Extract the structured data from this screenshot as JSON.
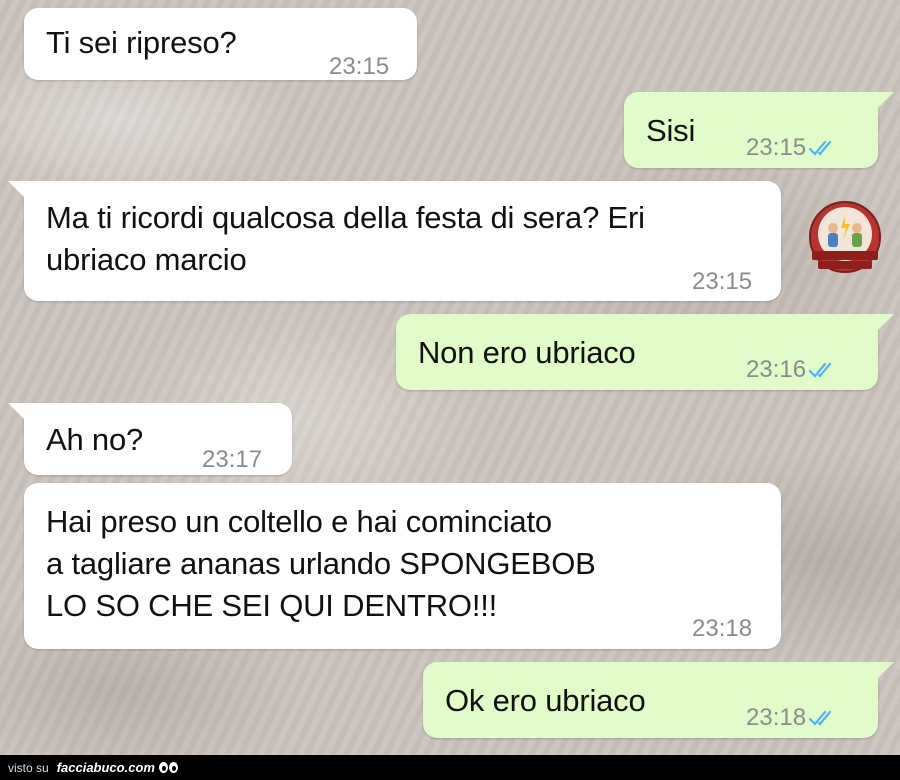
{
  "messages": [
    {
      "id": "b1",
      "direction": "incoming",
      "text": "Ti sei ripreso?",
      "time": "23:15"
    },
    {
      "id": "b2",
      "direction": "outgoing",
      "text": "Sisi",
      "time": "23:15",
      "status": "read"
    },
    {
      "id": "b3",
      "direction": "incoming",
      "text": "Ma ti ricordi qualcosa della festa di sera? Eri ubriaco marcio",
      "time": "23:15"
    },
    {
      "id": "b4",
      "direction": "outgoing",
      "text": "Non ero ubriaco",
      "time": "23:16",
      "status": "read"
    },
    {
      "id": "b5",
      "direction": "incoming",
      "text": "Ah no?",
      "time": "23:17"
    },
    {
      "id": "b6",
      "direction": "incoming",
      "text": "Hai preso un coltello e hai cominciato\na tagliare ananas urlando SPONGEBOB\nLO SO CHE SEI QUI DENTRO!!!",
      "time": "23:18"
    },
    {
      "id": "b7",
      "direction": "outgoing",
      "text": "Ok ero ubriaco",
      "time": "23:18",
      "status": "read"
    }
  ],
  "watermark": {
    "line1": "ROVINARE RAPPORTI",
    "line2": "CON USCITE INFELICI"
  },
  "footer": {
    "visto": "visto su",
    "brand": "facciabuco.com"
  },
  "colors": {
    "incoming_bubble": "#ffffff",
    "outgoing_bubble": "#e1fcc9",
    "time_text": "#8b8b8b",
    "read_ticks": "#4fb6ec"
  },
  "icons": {
    "read_receipt": "double-check-icon",
    "footer_eyes": "googly-eyes-icon"
  }
}
